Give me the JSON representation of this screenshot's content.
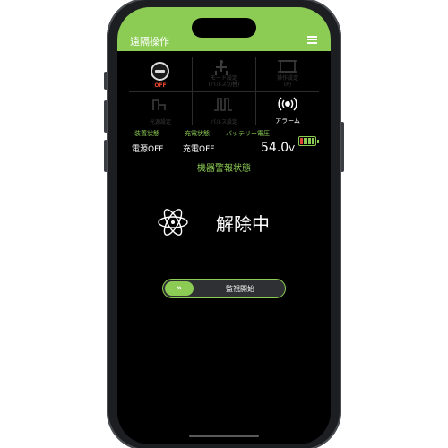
{
  "header": {
    "title": "遠隔操作"
  },
  "buttons": {
    "power_state": "OFF",
    "mode_setting": "モード設定\n(パルス切替)",
    "operation_setting": "操作設定\n(P)",
    "illumination_setting": "光源設定",
    "pulse_setting": "パルス設定",
    "alarm": "アラーム"
  },
  "status": {
    "device_label": "装置状態",
    "device_value": "電源OFF",
    "charge_label": "充電状態",
    "charge_value": "充電OFF",
    "battery_label": "バッテリー電圧",
    "battery_voltage": "54.0",
    "battery_unit": "V"
  },
  "alarm_section": {
    "title": "機器警報状態",
    "state": "解除中",
    "slider_knob": "»",
    "slider_label": "監視開始"
  },
  "colors": {
    "accent": "#8ccc55",
    "off": "#e8452f"
  }
}
